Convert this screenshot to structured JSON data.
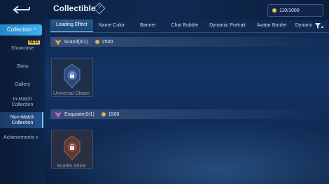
{
  "header": {
    "title": "Collectible",
    "help_label": "?",
    "points": "110/1000"
  },
  "sidebar": {
    "main_active": "Collection",
    "items": [
      "Showcase",
      "Skins",
      "Gallery",
      "In-Match Collection",
      "Non-Match Collection"
    ],
    "beta_label": "BETA",
    "achievements": "Achievements"
  },
  "tabs": [
    "Loading Effect",
    "Name Color",
    "Banner",
    "Chat Bubble",
    "Dynamic Portrait",
    "Avatar Border",
    "Dynami"
  ],
  "sections": [
    {
      "title": "Grand(0/1)",
      "cost": "2500",
      "items": [
        {
          "name": "Universal Gleam"
        }
      ]
    },
    {
      "title": "Exquisite(0/1)",
      "cost": "1500",
      "items": [
        {
          "name": "Scarlet Shine"
        }
      ]
    }
  ],
  "colors": {
    "accent": "#3db0ec",
    "grand": "#e0a850",
    "exquisite": "#d86ad4",
    "gold": "#e6c25e"
  },
  "icons": {
    "back": "back-arrow-icon",
    "help": "help-icon",
    "filter": "filter-icon",
    "lock": "lock-icon",
    "coin": "coin-icon"
  }
}
